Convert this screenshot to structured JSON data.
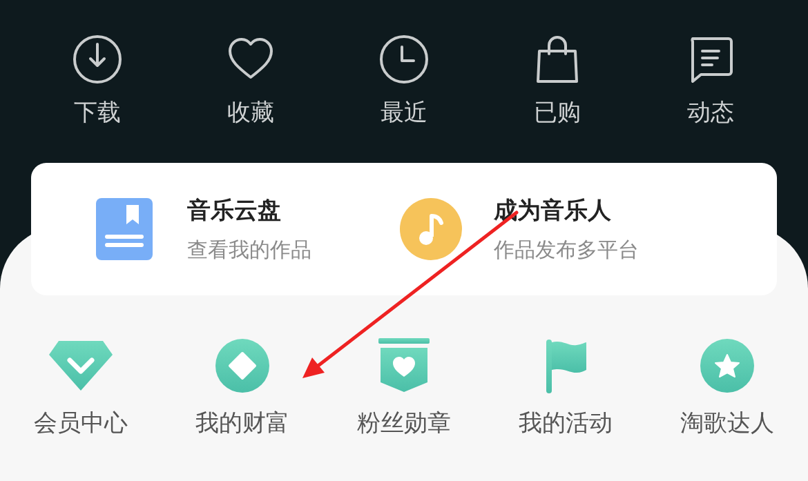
{
  "quick_actions": [
    {
      "kind": "download",
      "label": "下载"
    },
    {
      "kind": "favorite",
      "label": "收藏"
    },
    {
      "kind": "recent",
      "label": "最近"
    },
    {
      "kind": "purchased",
      "label": "已购"
    },
    {
      "kind": "feed",
      "label": "动态"
    }
  ],
  "card": [
    {
      "kind": "cloud",
      "title": "音乐云盘",
      "subtitle": "查看我的作品"
    },
    {
      "kind": "musician",
      "title": "成为音乐人",
      "subtitle": "作品发布多平台"
    }
  ],
  "services": [
    {
      "kind": "vip",
      "label": "会员中心"
    },
    {
      "kind": "wealth",
      "label": "我的财富"
    },
    {
      "kind": "badge",
      "label": "粉丝勋章"
    },
    {
      "kind": "activity",
      "label": "我的活动"
    },
    {
      "kind": "star",
      "label": "淘歌达人"
    }
  ],
  "annotation": {
    "kind": "arrow"
  }
}
